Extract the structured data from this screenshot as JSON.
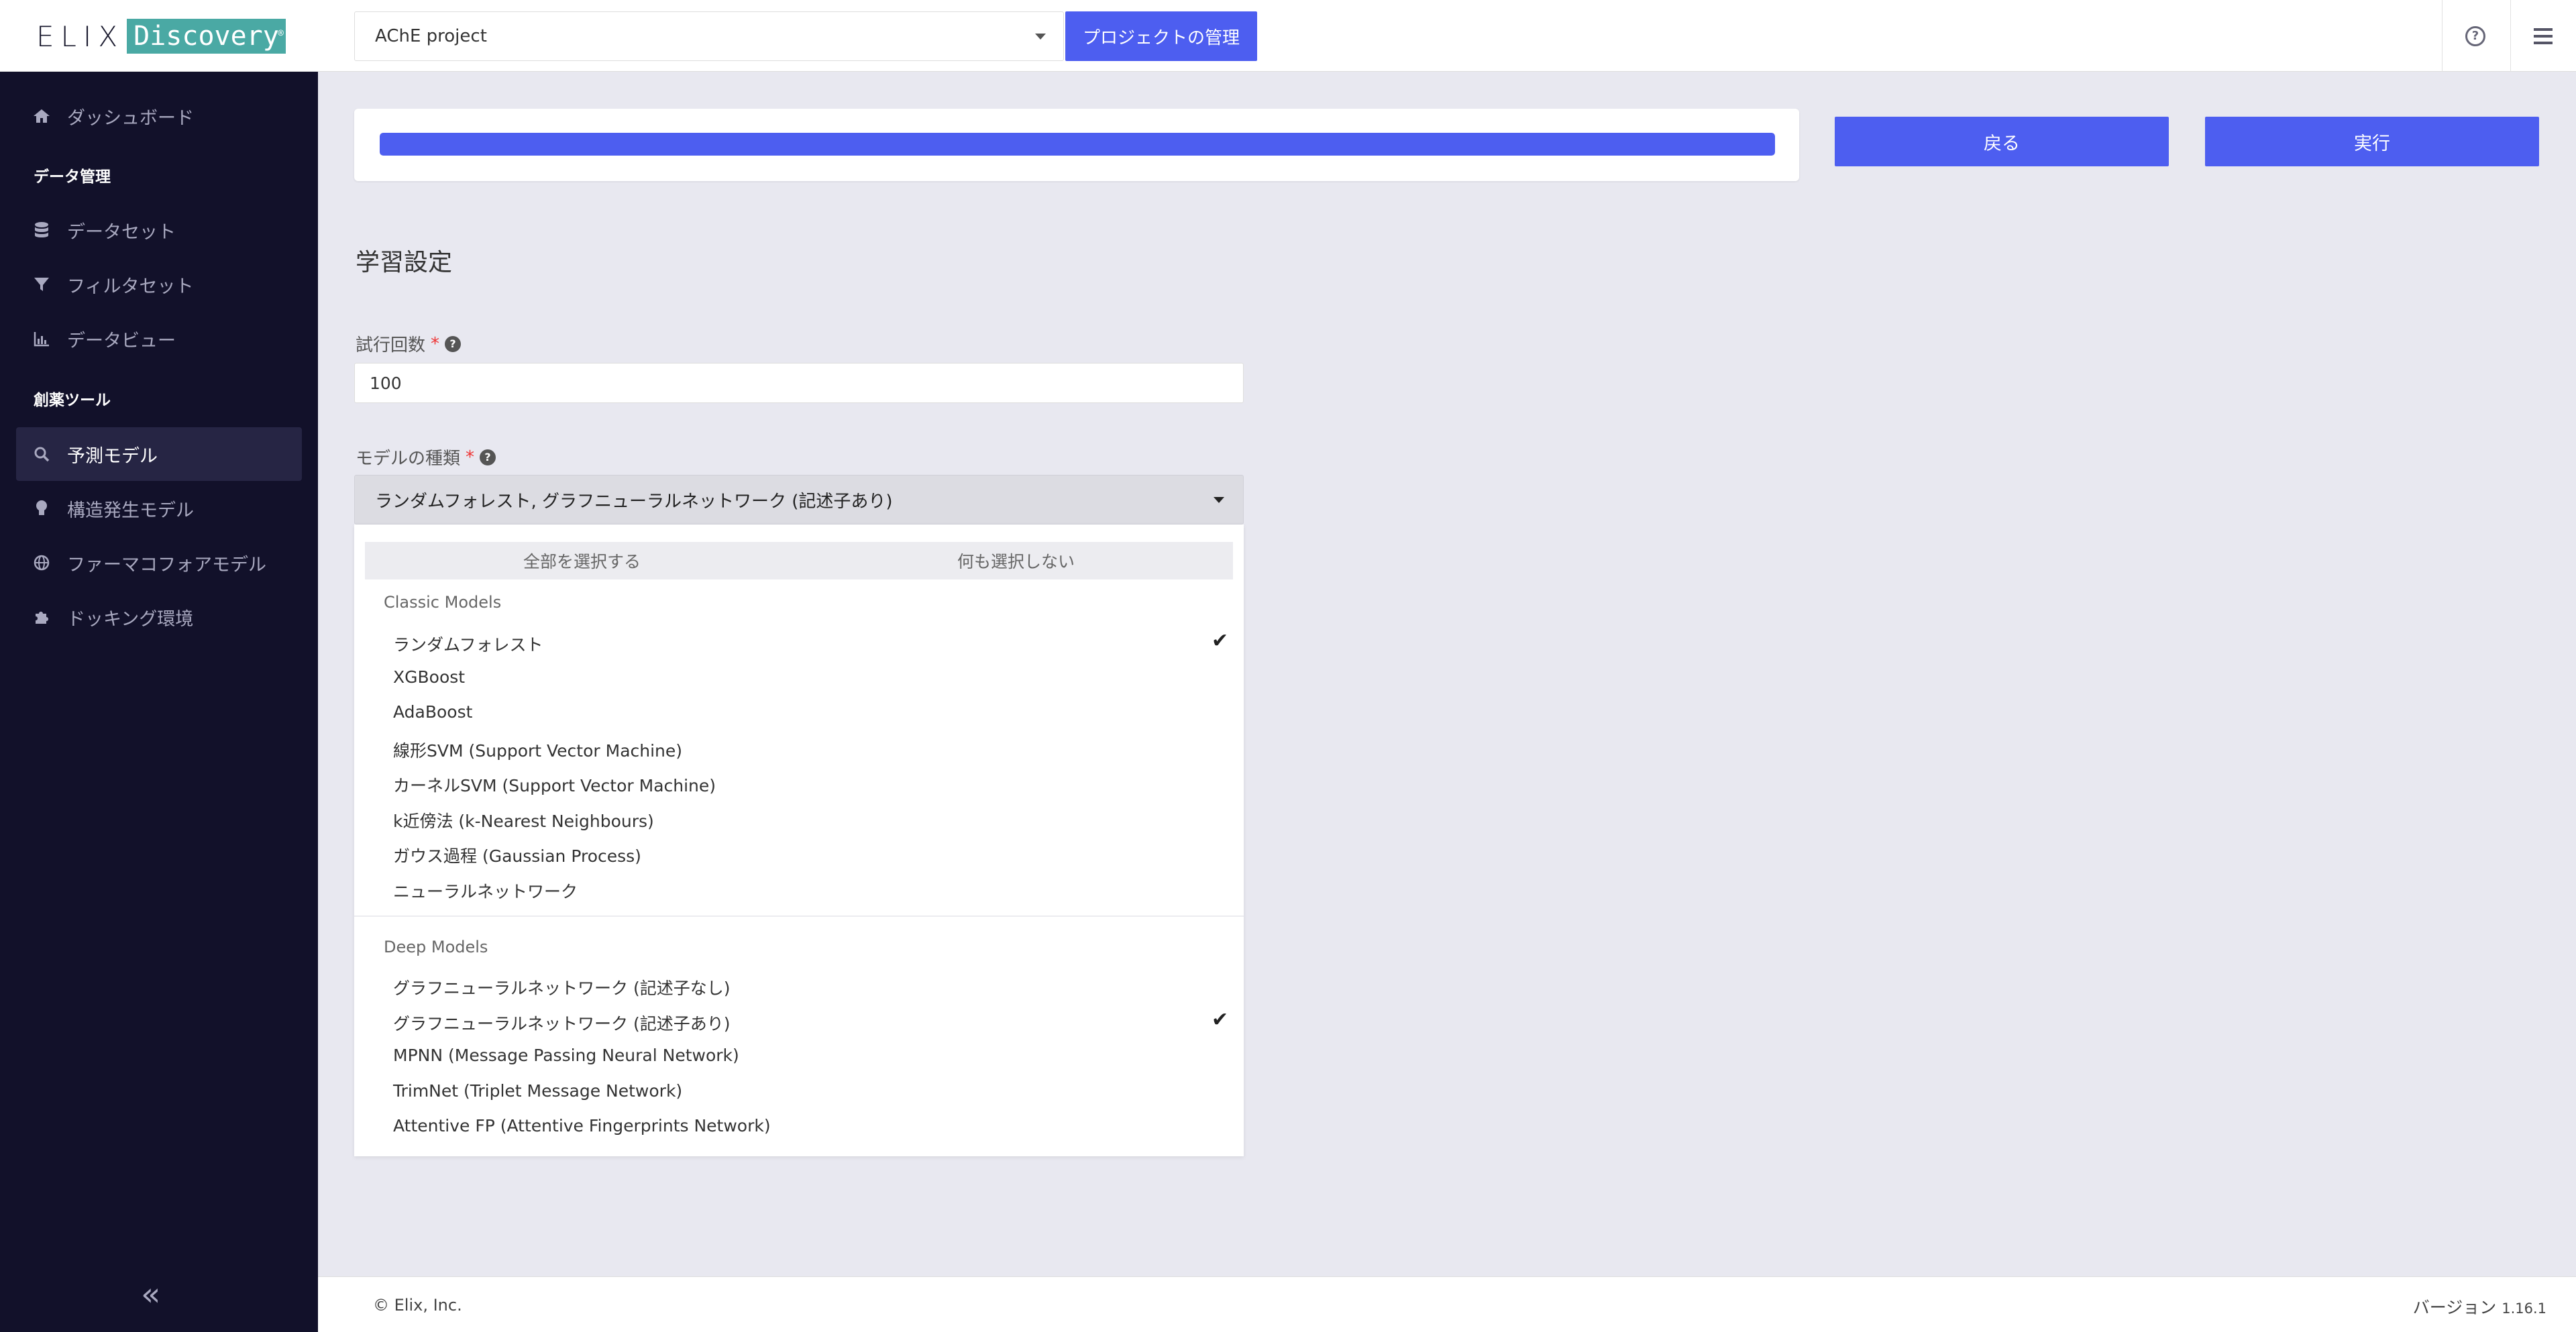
{
  "header": {
    "logo_text": "ELIX",
    "logo_badge": "Discovery",
    "project_value": "AChE project",
    "manage_label": "プロジェクトの管理"
  },
  "sidebar": {
    "dashboard": "ダッシュボード",
    "section_data": "データ管理",
    "datasets": "データセット",
    "filtersets": "フィルタセット",
    "dataview": "データビュー",
    "section_tools": "創薬ツール",
    "predictive": "予測モデル",
    "generative": "構造発生モデル",
    "pharmacophore": "ファーマコフォアモデル",
    "docking": "ドッキング環境",
    "collapse": "«"
  },
  "progress": {
    "fill_percent": 100
  },
  "actions": {
    "back": "戻る",
    "run": "実行"
  },
  "form": {
    "title": "学習設定",
    "trials_label": "試行回数",
    "trials_value": "100",
    "model_label": "モデルの種類",
    "model_value": "ランダムフォレスト, グラフニューラルネットワーク (記述子あり)"
  },
  "dropdown": {
    "select_all": "全部を選択する",
    "select_none": "何も選択しない",
    "classic_header": "Classic Models",
    "classic": [
      {
        "label": "ランダムフォレスト",
        "checked": true
      },
      {
        "label": "XGBoost",
        "checked": false
      },
      {
        "label": "AdaBoost",
        "checked": false
      },
      {
        "label": "線形SVM (Support Vector Machine)",
        "checked": false
      },
      {
        "label": "カーネルSVM (Support Vector Machine)",
        "checked": false
      },
      {
        "label": "k近傍法 (k-Nearest Neighbours)",
        "checked": false
      },
      {
        "label": "ガウス過程 (Gaussian Process)",
        "checked": false
      },
      {
        "label": "ニューラルネットワーク",
        "checked": false
      }
    ],
    "deep_header": "Deep Models",
    "deep": [
      {
        "label": "グラフニューラルネットワーク (記述子なし)",
        "checked": false
      },
      {
        "label": "グラフニューラルネットワーク (記述子あり)",
        "checked": true
      },
      {
        "label": "MPNN (Message Passing Neural Network)",
        "checked": false
      },
      {
        "label": "TrimNet (Triplet Message Network)",
        "checked": false
      },
      {
        "label": "Attentive FP (Attentive Fingerprints Network)",
        "checked": false
      }
    ],
    "check_glyph": "✔"
  },
  "footer": {
    "copyright": "© Elix, Inc.",
    "version_label": "バージョン",
    "version_number": "1.16.1"
  }
}
